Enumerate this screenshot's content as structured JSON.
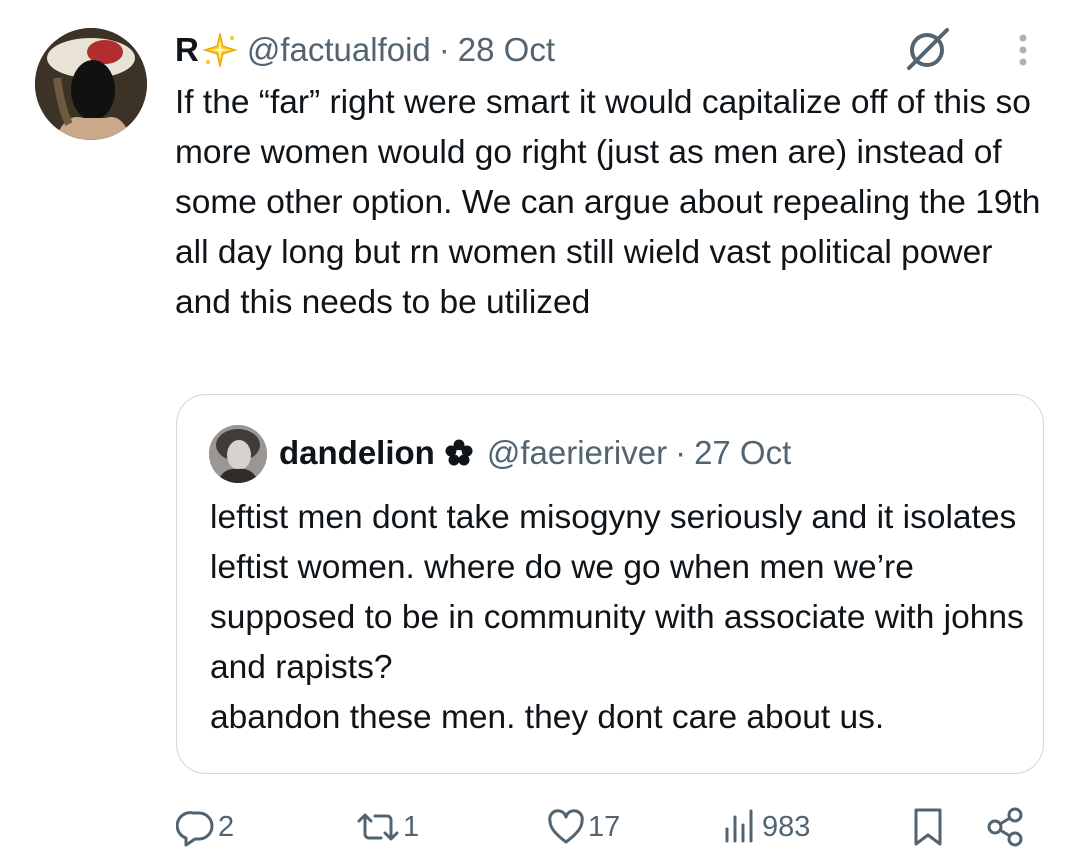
{
  "tweet": {
    "display_name": "R",
    "handle": "@factualfoid",
    "separator": "·",
    "date": "28 Oct",
    "text": "If the “far” right were smart it would capitalize off of this so more women would go right (just as men are) instead of some other option. We can argue about repealing the 19th all day long but rn women still wield vast political power and this needs to be utilized"
  },
  "quote": {
    "display_name": "dandelion",
    "handle": "@faerieriver",
    "separator": "·",
    "date": "27 Oct",
    "text": "leftist men dont take misogyny seriously and it isolates leftist women. where do we go when men we’re supposed to be in community with associate with johns and rapists?\nabandon these men. they dont care about us."
  },
  "actions": {
    "replies": "2",
    "reposts": "1",
    "likes": "17",
    "views": "983"
  },
  "icons": {
    "name_badge": "sparkle-icon",
    "quote_badge": "flower-icon",
    "grok": "grok-icon",
    "more": "more-icon",
    "reply": "reply-icon",
    "repost": "repost-icon",
    "like": "like-icon",
    "views": "views-icon",
    "bookmark": "bookmark-icon",
    "share": "share-icon"
  },
  "colors": {
    "text": "#0f1419",
    "secondary": "#536471",
    "border": "#cfd9de",
    "sparkle": "#f5c518"
  }
}
